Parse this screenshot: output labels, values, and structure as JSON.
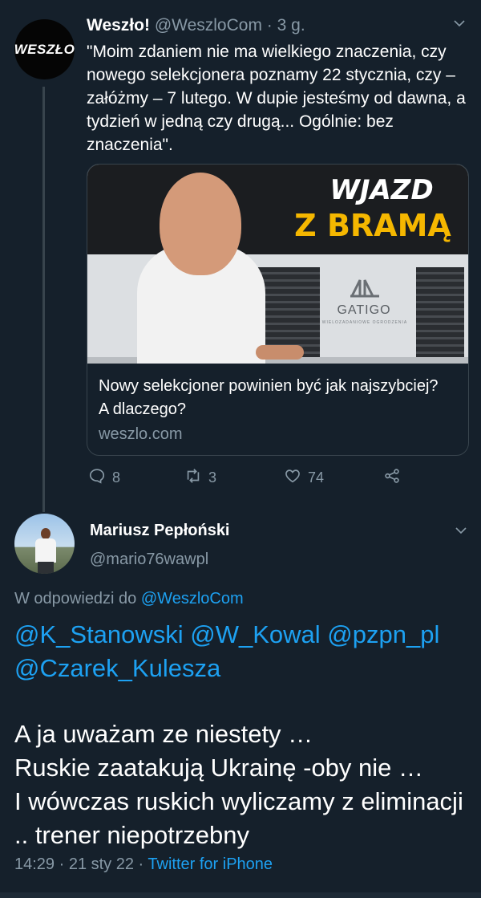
{
  "tweet1": {
    "avatar_text": "WESZŁO",
    "name": "Weszło!",
    "handle": "@WeszloCom",
    "separator": "·",
    "time": "3 g.",
    "text": "\"Moim zdaniem nie ma wielkiego znaczenia, czy nowego selekcjonera poznamy 22 stycznia, czy – załóżmy – 7 lutego. W dupie jesteśmy od dawna, a tydzień w jedną czy drugą... Ogólnie: bez znaczenia\".",
    "card": {
      "image_heading_line1": "WJAZD",
      "image_heading_line2": "Z BRAMĄ",
      "brand_name": "GATIGO",
      "brand_tagline": "WIELOZADANIOWE OGRODZENIA",
      "title": "Nowy selekcjoner powinien być jak najszybciej? A dlaczego?",
      "domain": "weszlo.com"
    },
    "actions": {
      "replies": "8",
      "retweets": "3",
      "likes": "74"
    }
  },
  "tweet2": {
    "name": "Mariusz Pepłoński",
    "handle": "@mario76wawpl",
    "reply_prefix": "W odpowiedzi do",
    "reply_to": "@WeszloCom",
    "mentions": "@K_Stanowski @W_Kowal @pzpn_pl @Czarek_Kulesza",
    "body": "A ja uważam ze niestety …\nRuskie zaatakują Ukrainę -oby nie …\nI wówczas ruskich wyliczamy z eliminacji .. trener niepotrzebny",
    "timestamp": "14:29 · 21 sty 22 ·",
    "source": "Twitter for iPhone"
  },
  "colors": {
    "background": "#15202b",
    "link": "#1da1f2",
    "muted": "#8899a6",
    "border": "#38444d",
    "brand_accent": "#f5b700"
  },
  "icons": [
    "reply-icon",
    "retweet-icon",
    "like-icon",
    "share-icon",
    "chevron-down-icon"
  ]
}
